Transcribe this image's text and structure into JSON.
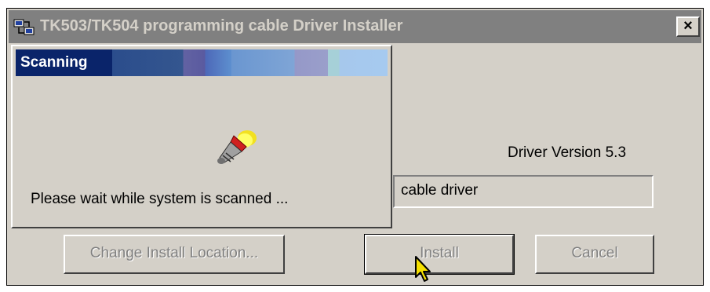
{
  "window": {
    "title": "TK503/TK504 programming cable Driver Installer",
    "close_label": "×",
    "driver_version": "Driver Version 5.3",
    "path_text": "cable driver"
  },
  "buttons": {
    "change_location": "Change Install Location...",
    "install": "Install",
    "cancel": "Cancel"
  },
  "scan_dialog": {
    "title": "Scanning",
    "message": "Please wait while system is scanned ..."
  },
  "icons": [
    "installer-app-icon",
    "flashlight-icon",
    "arrow-cursor-icon"
  ],
  "colors": {
    "dialog_face": "#d4d0c8",
    "inactive_titlebar": "#808080",
    "active_title_start": "#0a246a",
    "active_title_end": "#a6caf0"
  }
}
